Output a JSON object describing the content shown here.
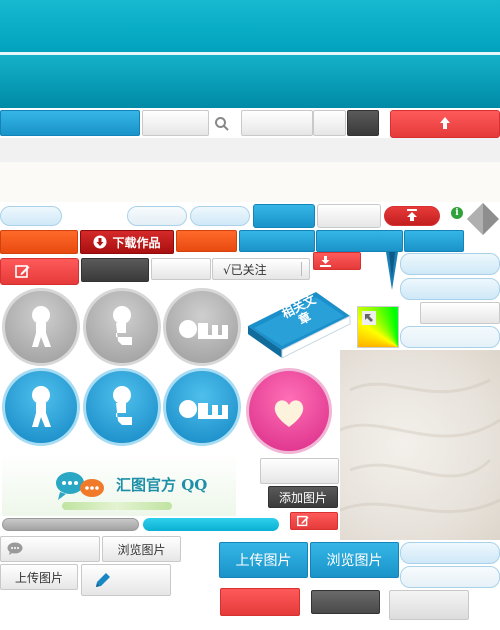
{
  "buttons": {
    "download_works": "下载作品",
    "followed": "√已关注",
    "add_image": "添加图片",
    "browse_image_small": "浏览图片",
    "upload_image_small": "上传图片",
    "upload_image_large": "上传图片",
    "browse_image_large": "浏览图片"
  },
  "banner": {
    "qq_text": "汇图官方 QQ"
  },
  "book_icon": {
    "text": "相关文章"
  },
  "progress": {
    "gray_bar": 1.0,
    "cyan_bar": 1.0
  },
  "colors": {
    "teal_header": "#00a9c4",
    "teal_dark": "#008ca8",
    "blue": "#1a93c9",
    "orange": "#f0541a",
    "red": "#e53a3a",
    "dark": "#3d3d3d",
    "pink": "#e0378f",
    "green": "#2fa33a"
  }
}
